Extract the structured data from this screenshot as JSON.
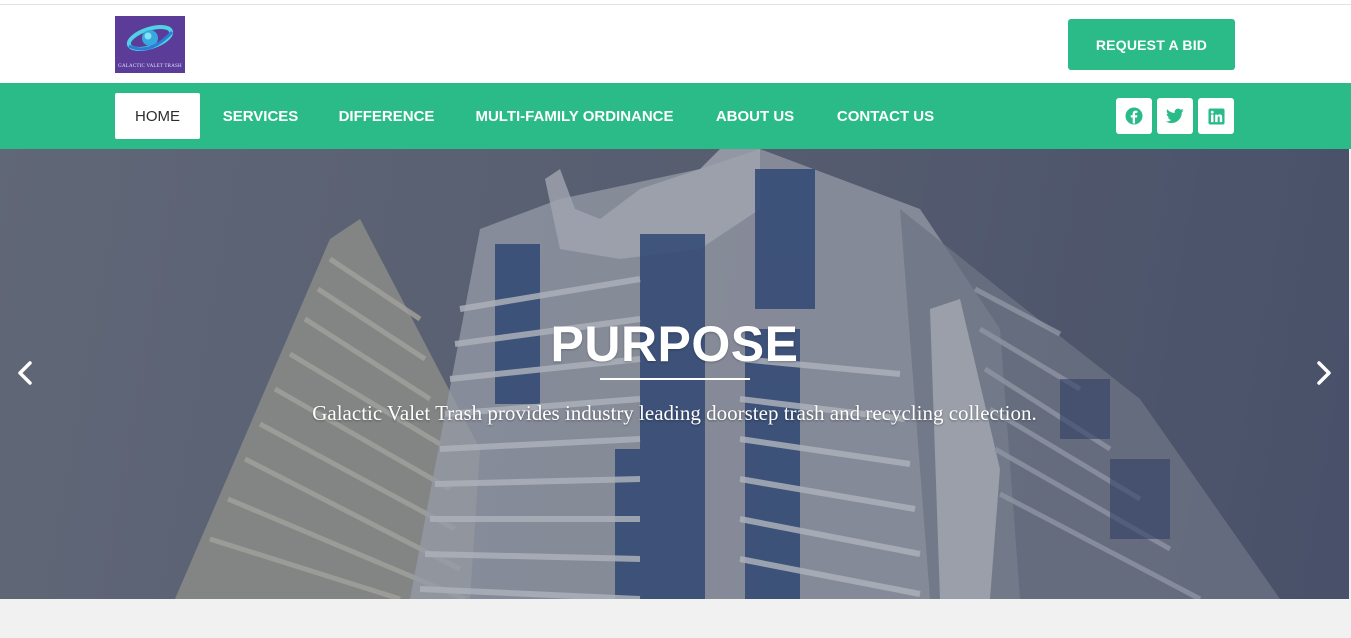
{
  "brand": {
    "logo_text": "GALACTIC VALET TRASH",
    "colors": {
      "accent": "#2abb88",
      "logo_bg": "#5b3d99",
      "hero_overlay": "#5f6678"
    }
  },
  "header": {
    "cta_label": "REQUEST A BID"
  },
  "nav": {
    "items": [
      {
        "label": "HOME",
        "active": true
      },
      {
        "label": "SERVICES",
        "active": false
      },
      {
        "label": "DIFFERENCE",
        "active": false
      },
      {
        "label": "MULTI-FAMILY ORDINANCE",
        "active": false
      },
      {
        "label": "ABOUT US",
        "active": false
      },
      {
        "label": "CONTACT US",
        "active": false
      }
    ],
    "social": [
      {
        "icon": "facebook-icon"
      },
      {
        "icon": "twitter-icon"
      },
      {
        "icon": "linkedin-icon"
      }
    ]
  },
  "hero": {
    "title": "PURPOSE",
    "text": "Galactic Valet Trash provides industry leading doorstep trash and recycling collection.",
    "prev_icon": "chevron-left-icon",
    "next_icon": "chevron-right-icon"
  }
}
